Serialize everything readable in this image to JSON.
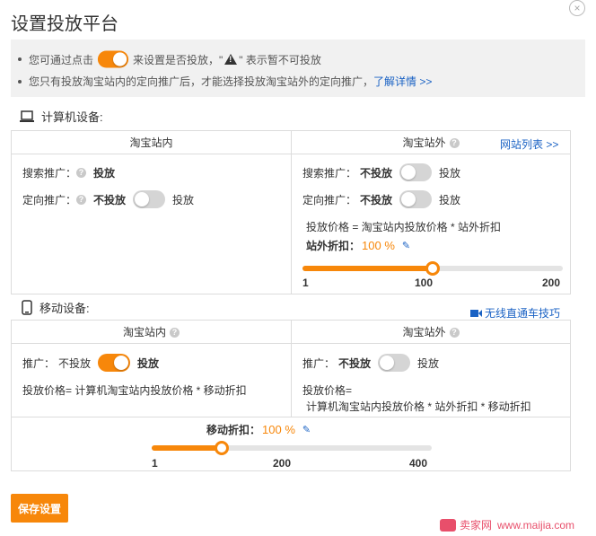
{
  "dialog": {
    "title": "设置投放平台",
    "close": "×"
  },
  "notice": {
    "line1_prefix": "您可通过点击",
    "line1_mid": "来设置是否投放，\"",
    "line1_suffix": "\" 表示暂不可投放",
    "line2_text": "您只有投放淘宝站内的定向推广后，才能选择投放淘宝站外的定向推广，",
    "line2_link": "了解详情 >>"
  },
  "computer": {
    "heading": "计算机设备:",
    "icon": "laptop-icon",
    "col_inside": "淘宝站内",
    "col_outside": "淘宝站外",
    "site_list_link": "网站列表 >>",
    "inside": {
      "search_label": "搜索推广：",
      "search_value": "投放",
      "target_label": "定向推广：",
      "target_off": "不投放",
      "target_on": "投放"
    },
    "outside": {
      "search_label": "搜索推广：",
      "search_off": "不投放",
      "search_on": "投放",
      "target_label": "定向推广：",
      "target_off": "不投放",
      "target_on": "投放",
      "formula": "投放价格 = 淘宝站内投放价格 * 站外折扣",
      "discount_label": "站外折扣：",
      "discount_value": "100 %",
      "slider": {
        "min": 1,
        "max": 200,
        "value": 100,
        "ticks": [
          "1",
          "100",
          "200"
        ]
      }
    }
  },
  "mobile": {
    "heading": "移动设备:",
    "icon": "phone-icon",
    "video_link": "无线直通车技巧",
    "col_inside": "淘宝站内",
    "col_outside": "淘宝站外",
    "inside": {
      "promo_label": "推广：",
      "promo_off": "不投放",
      "promo_on": "投放",
      "formula": "投放价格= 计算机淘宝站内投放价格 * 移动折扣"
    },
    "outside": {
      "promo_label": "推广：",
      "promo_off": "不投放",
      "promo_on": "投放",
      "formula_line1": "投放价格=",
      "formula_line2": "计算机淘宝站内投放价格 * 站外折扣 * 移动折扣"
    },
    "discount_label": "移动折扣：",
    "discount_value": "100 %",
    "slider": {
      "min": 1,
      "max": 400,
      "value": 100,
      "ticks": [
        "1",
        "200",
        "400"
      ]
    }
  },
  "save_button": "保存设置",
  "watermark": {
    "brand": "卖家网",
    "url": "www.maijia.com"
  },
  "colors": {
    "accent": "#f7870a",
    "link": "#1a62c4",
    "border": "#dcdcdc"
  }
}
